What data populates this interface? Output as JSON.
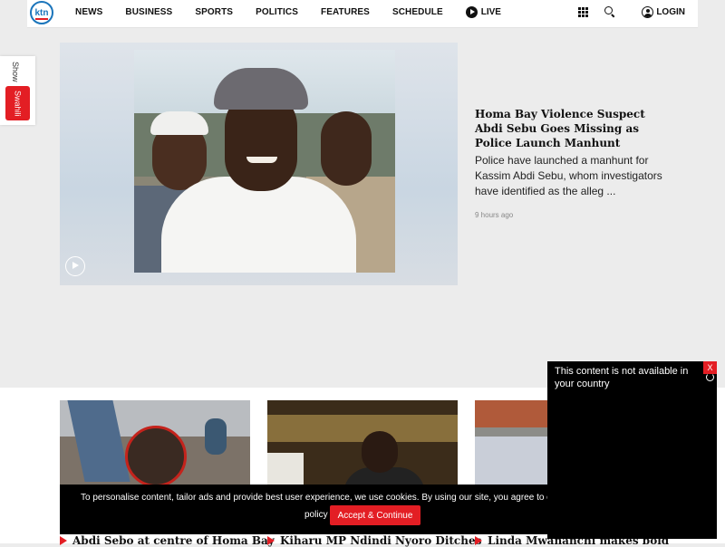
{
  "header": {
    "logo_text": "ktn",
    "nav": [
      "NEWS",
      "BUSINESS",
      "SPORTS",
      "POLITICS",
      "FEATURES",
      "SCHEDULE"
    ],
    "live_label": "LIVE",
    "login_label": "LOGIN"
  },
  "language_tab": {
    "show": "Show",
    "language": "Swahili"
  },
  "featured": {
    "headline": "Homa Bay Violence Suspect Abdi Sebu Goes Missing as Police Launch Manhunt",
    "summary": "Police have launched a manhunt for Kassim Abdi Sebu, whom investigators have identified as the alleg ...",
    "time": "9 hours ago"
  },
  "cards": [
    {
      "title": "Abdi Sebo at centre of Homa Bay"
    },
    {
      "title": "Kiharu MP Ndindi Nyoro Ditches"
    },
    {
      "title": "Linda Mwananchi makes bold"
    }
  ],
  "cookie_banner": {
    "text": "To personalise content, tailor ads and provide best user experience, we use cookies. By using our site, you agree to o",
    "policy": "policy",
    "accept_label": "Accept & Continue"
  },
  "video_popup": {
    "message": "This content is not available in your country",
    "close_label": "X"
  },
  "colors": {
    "brand_red": "#e31e24",
    "brand_blue": "#1b75bb"
  }
}
